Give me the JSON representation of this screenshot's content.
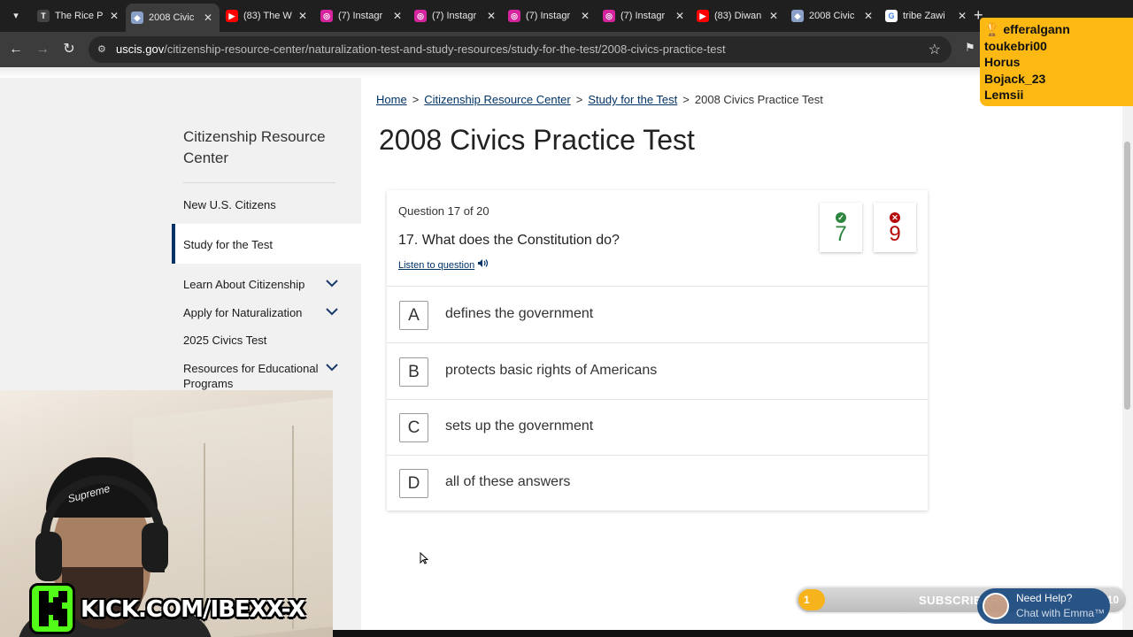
{
  "browser": {
    "tabs": [
      {
        "title": "The Rice P",
        "favicon": "T",
        "color": "#444444",
        "active": false
      },
      {
        "title": "2008 Civic",
        "favicon": "uscis",
        "color": "#8aa0c8",
        "active": true
      },
      {
        "title": "(83) The W",
        "favicon": "youtube",
        "color": "#ff0000",
        "active": false
      },
      {
        "title": "(7) Instagr",
        "favicon": "instagram",
        "color": "#d6249f",
        "active": false
      },
      {
        "title": "(7) Instagr",
        "favicon": "instagram",
        "color": "#d6249f",
        "active": false
      },
      {
        "title": "(7) Instagr",
        "favicon": "instagram",
        "color": "#d6249f",
        "active": false
      },
      {
        "title": "(7) Instagr",
        "favicon": "instagram",
        "color": "#d6249f",
        "active": false
      },
      {
        "title": "(83) Diwan",
        "favicon": "youtube",
        "color": "#ff0000",
        "active": false
      },
      {
        "title": "2008 Civic",
        "favicon": "uscis",
        "color": "#8aa0c8",
        "active": false
      },
      {
        "title": "tribe Zawi",
        "favicon": "google",
        "color": "#4285f4",
        "active": false
      }
    ],
    "url_host": "uscis.gov",
    "url_path": "/citizenship-resource-center/naturalization-test-and-study-resources/study-for-the-test/2008-civics-practice-test"
  },
  "sidebar": {
    "title": "Citizenship Resource Center",
    "items": [
      {
        "label": "New U.S. Citizens",
        "expandable": false,
        "active": false
      },
      {
        "label": "Study for the Test",
        "expandable": false,
        "active": true
      },
      {
        "label": "Learn About Citizenship",
        "expandable": true,
        "active": false
      },
      {
        "label": "Apply for Naturalization",
        "expandable": true,
        "active": false
      },
      {
        "label": "2025 Civics Test",
        "expandable": false,
        "active": false
      },
      {
        "label": "Resources for Educational Programs",
        "expandable": true,
        "active": false
      }
    ]
  },
  "breadcrumb": [
    {
      "label": "Home",
      "link": true
    },
    {
      "label": "Citizenship Resource Center",
      "link": true
    },
    {
      "label": "Study for the Test",
      "link": true
    },
    {
      "label": "2008 Civics Practice Test",
      "link": false
    }
  ],
  "page_title": "2008 Civics Practice Test",
  "quiz": {
    "progress": "Question 17 of 20",
    "question": "17. What does the Constitution do?",
    "listen_label": "Listen to question",
    "correct_count": "7",
    "incorrect_count": "9",
    "answers": [
      {
        "letter": "A",
        "text": "defines the government"
      },
      {
        "letter": "B",
        "text": "protects basic rights of Americans"
      },
      {
        "letter": "C",
        "text": "sets up the government"
      },
      {
        "letter": "D",
        "text": "all of these answers"
      }
    ]
  },
  "overlay": {
    "top_supporters": [
      "efferalgann",
      "toukebri00",
      "Horus",
      "Bojack_23",
      "Lemsii"
    ],
    "kick_url": "KICK.COM/IBEXX-X",
    "sub_goal": {
      "current": "1",
      "label": "SUBSCRIBERS",
      "target": "10",
      "progress": 0.1
    },
    "help": {
      "line1": "Need Help?",
      "line2": "Chat with Emma™"
    }
  },
  "colors": {
    "link": "#003366",
    "correct": "#2e8540",
    "incorrect": "#b50909",
    "kick_green": "#53fc18",
    "supporter_box": "#fcb813"
  }
}
